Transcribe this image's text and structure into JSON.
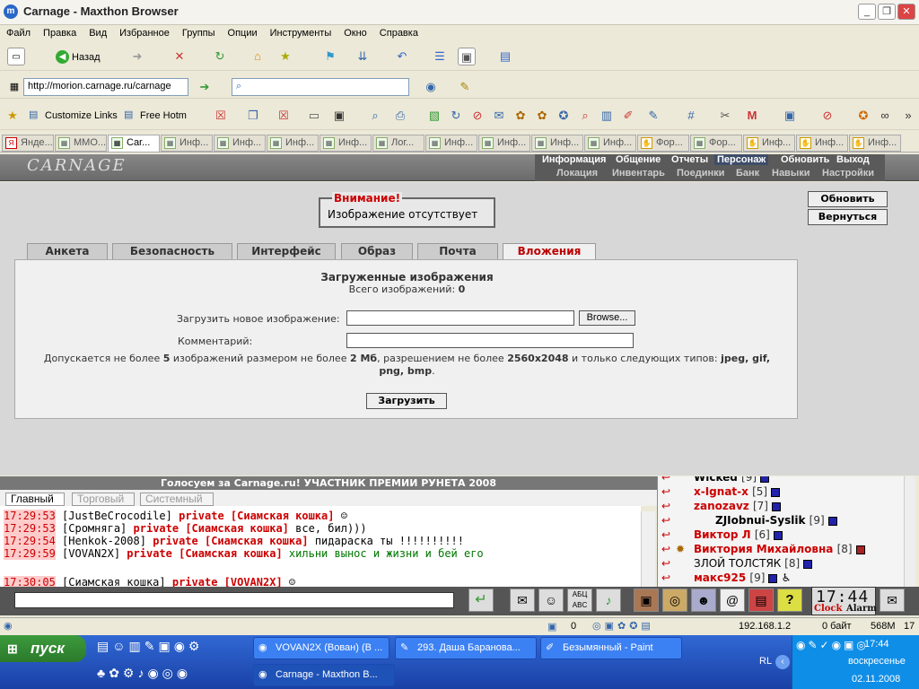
{
  "window": {
    "title": "Carnage - Maxthon Browser"
  },
  "menu": [
    "Файл",
    "Правка",
    "Вид",
    "Избранное",
    "Группы",
    "Опции",
    "Инструменты",
    "Окно",
    "Справка"
  ],
  "toolbar": {
    "back_label": "Назад"
  },
  "address": {
    "url": "http://morion.carnage.ru/carnage"
  },
  "links": {
    "customize": "Customize Links",
    "hotmail": "Free Hotm"
  },
  "browser_tabs": [
    "Янде...",
    "MMO...",
    "Car...",
    "Инф...",
    "Инф...",
    "Инф...",
    "Инф...",
    "Лог...",
    "Инф...",
    "Инф...",
    "Инф...",
    "Инф...",
    "Фор...",
    "Фор...",
    "Инф...",
    "Инф...",
    "Инф..."
  ],
  "game": {
    "logo": "CARNAGE",
    "nav_top": [
      "Информация",
      "Общение",
      "Отчеты",
      "Персонаж",
      "Обновить",
      "Выход"
    ],
    "nav_bottom": [
      "Локация",
      "Инвентарь",
      "Поединки",
      "Банк",
      "Навыки",
      "Настройки"
    ],
    "warning_title": "Внимание!",
    "warning_text": "Изображение отсутствует",
    "btn_refresh": "Обновить",
    "btn_back": "Вернуться",
    "tabs": [
      "Анкета",
      "Безопасность",
      "Интерфейс",
      "Образ",
      "Почта",
      "Вложения"
    ],
    "panel": {
      "heading": "Загруженные изображения",
      "count_label": "Всего изображений:",
      "count": "0",
      "upload_label": "Загрузить новое изображение:",
      "browse": "Browse...",
      "comment_label": "Комментарий:",
      "rules_1": "Допускается не более",
      "rules_n": "5",
      "rules_2": "изображений размером не более",
      "rules_size": "2 Мб",
      "rules_3": ", разрешением не более",
      "rules_res": "2560x2048",
      "rules_4": "и только следующих типов:",
      "rules_types": "jpeg, gif, png, bmp",
      "rules_end": ".",
      "submit": "Загрузить"
    }
  },
  "vote": "Голосуем за Carnage.ru! УЧАСТНИК ПРЕМИИ РУНЕТА 2008",
  "chat": {
    "tabs": [
      "Главный",
      "Торговый",
      "Системный"
    ],
    "lines": [
      {
        "time": "17:29:53",
        "from": "[JustBeCrocodile]",
        "priv": "private [Сиамская кошка]",
        "msg": ""
      },
      {
        "time": "17:29:53",
        "from": "[Сромняга]",
        "priv": "private [Сиамская кошка]",
        "msg": "все, бил)))"
      },
      {
        "time": "17:29:54",
        "from": "[Henkok-2008]",
        "priv": "private [Сиамская кошка]",
        "msg": "пидараска ты !!!!!!!!!!"
      },
      {
        "time": "17:29:59",
        "from": "[VOVAN2X]",
        "priv": "private [Сиамская кошка]",
        "msg": "хильни вынос и жизни и бей его"
      },
      {
        "time": "17:30:05",
        "from": "[Сиамская кошка]",
        "priv": "private [VOVAN2X]",
        "msg": ""
      }
    ]
  },
  "users": [
    {
      "name": "Wicked",
      "level": "[9]"
    },
    {
      "name": "x-Ignat-x",
      "level": "[5]"
    },
    {
      "name": "zanozavz",
      "level": "[7]"
    },
    {
      "name": "ZJIobnui-Syslik",
      "level": "[9]"
    },
    {
      "name": "Виктор Л",
      "level": "[6]"
    },
    {
      "name": "Виктория Михайловна",
      "level": "[8]"
    },
    {
      "name": "ЗЛОЙ ТОЛСТЯК",
      "level": "[8]"
    },
    {
      "name": "макс925",
      "level": "[9]"
    }
  ],
  "clock": {
    "time": "17:44",
    "clock_label": "Clock",
    "alarm_label": "Alarm"
  },
  "status": {
    "count": "0",
    "ip": "192.168.1.2",
    "bytes": "0 байт",
    "mem": "568M",
    "num": "17"
  },
  "taskbar": {
    "start": "пуск",
    "tasks": [
      "VOVAN2X (Вован) (В ...",
      "293. Даша Баранова...",
      "Безымянный - Paint",
      "Carnage - Maxthon B..."
    ],
    "lang": "RL",
    "time": "17:44",
    "day": "воскресенье",
    "date": "02.11.2008"
  }
}
